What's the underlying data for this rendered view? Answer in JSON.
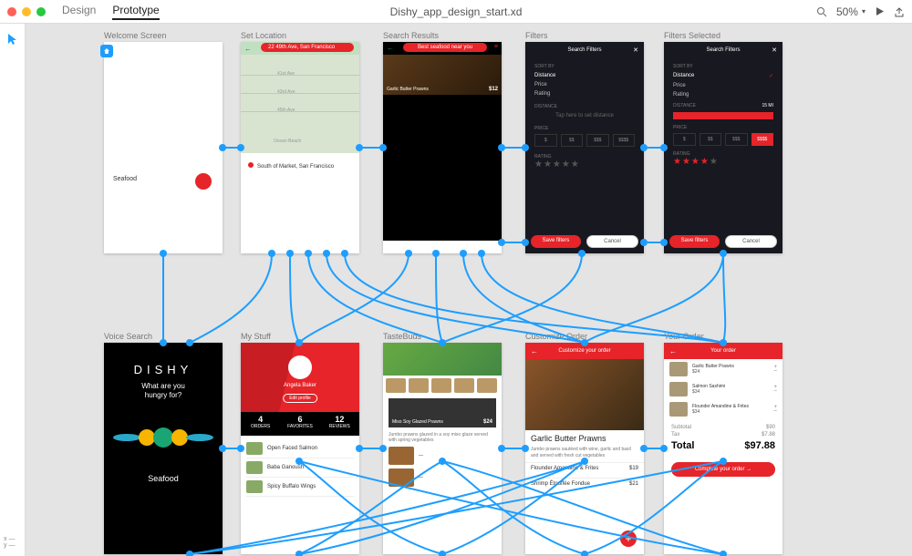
{
  "header": {
    "tab_design": "Design",
    "tab_prototype": "Prototype",
    "doc_title": "Dishy_app_design_start.xd",
    "zoom": "50%"
  },
  "artboards": {
    "welcome": {
      "label": "Welcome Screen",
      "input": "Seafood"
    },
    "location": {
      "label": "Set Location",
      "pill": "22 49th Ave, San Francisco",
      "streets": [
        "41st Ave",
        "43rd Ave",
        "45th Ave"
      ],
      "area": "Ocean Beach",
      "sheet": "South of Market, San Francisco"
    },
    "results": {
      "label": "Search Results",
      "pill": "Best seafood near you",
      "item_name": "Garlic Butter Prawns",
      "item_price": "$12"
    },
    "filters": {
      "label": "Filters",
      "title": "Search Filters",
      "sort_label": "SORT BY",
      "sort_distance": "Distance",
      "sort_price": "Price",
      "sort_rating": "Rating",
      "dist_label": "DISTANCE",
      "dist_hint": "Tap here to set distance",
      "price_label": "PRICE",
      "p1": "$",
      "p2": "$$",
      "p3": "$$$",
      "p4": "$$$$",
      "rating_label": "RATING",
      "save": "Save filters",
      "cancel": "Cancel"
    },
    "filters_sel": {
      "label": "Filters Selected",
      "title": "Search Filters",
      "distance_val": "15 mi",
      "save": "Save filters",
      "cancel": "Cancel"
    },
    "voice": {
      "label": "Voice Search",
      "logo": "DISHY",
      "question": "What are you\nhungry for?",
      "result": "Seafood"
    },
    "mystuff": {
      "label": "My Stuff",
      "name": "Angela Baker",
      "edit": "Edit profile",
      "s1": "4",
      "s1l": "ORDERS",
      "s2": "6",
      "s2l": "FAVORITES",
      "s3": "12",
      "s3l": "REVIEWS",
      "i1": "Open Faced Salmon",
      "i2": "Baba Ganoush",
      "i3": "Spicy Buffalo Wings"
    },
    "tastebuds": {
      "label": "TasteBuds",
      "card_name": "Miso Soy Glazed Prawns",
      "card_price": "$24",
      "desc": "Jumbo prawns glazed in a soy miso glaze served with spring vegetables"
    },
    "customize": {
      "label": "Customize Order",
      "title": "Customize your order",
      "dish": "Garlic Butter Prawns",
      "desc": "Jumbo prawns sautéed with wine, garlic and basil and served with fresh cut vegetables",
      "r1": "Flounder Amandine & Frites",
      "r1p": "$19",
      "r2": "Shrimp Étouffée Fondue",
      "r2p": "$21"
    },
    "order": {
      "label": "Your Order",
      "title": "Your order",
      "i1": "Garlic Butter Prawns",
      "i1p": "$24",
      "i2": "Salmon Sashimi",
      "i2p": "$34",
      "i3": "Flounder Amandine & Frites",
      "i3p": "$34",
      "sub_l": "Subtotal",
      "sub_v": "$90",
      "tax_l": "Tax",
      "tax_v": "$7.88",
      "tot_l": "Total",
      "tot_v": "$97.88",
      "cta": "Complete your order   →"
    }
  }
}
